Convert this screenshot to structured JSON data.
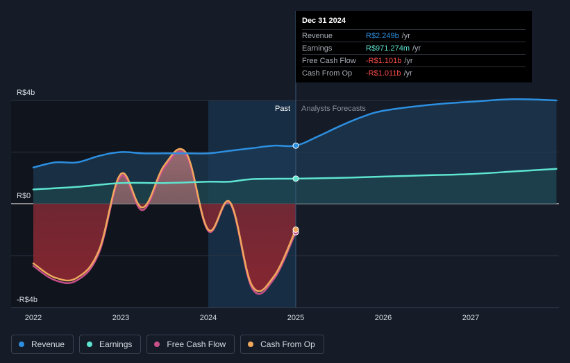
{
  "chart_data": {
    "type": "line",
    "y_ticks": [
      "R$4b",
      "R$0",
      "-R$4b"
    ],
    "x_ticks": [
      "2022",
      "2023",
      "2024",
      "2025",
      "2026",
      "2027"
    ],
    "ylim": [
      -4,
      4
    ],
    "xlim": [
      2021.78,
      2027.98
    ],
    "past_label": "Past",
    "forecast_label": "Analysts Forecasts",
    "forecast_start": 2025.0,
    "series": [
      {
        "name": "Revenue",
        "color": "#2d8fe0",
        "x": [
          2022.0,
          2022.25,
          2022.5,
          2022.75,
          2023.0,
          2023.25,
          2023.5,
          2023.75,
          2024.0,
          2024.25,
          2024.5,
          2024.75,
          2025.0,
          2025.25,
          2025.5,
          2025.75,
          2026.0,
          2026.5,
          2027.0,
          2027.5,
          2027.98
        ],
        "values": [
          1.4,
          1.6,
          1.6,
          1.85,
          2.0,
          1.95,
          1.95,
          1.95,
          1.95,
          2.05,
          2.15,
          2.25,
          2.25,
          2.6,
          3.0,
          3.35,
          3.6,
          3.82,
          3.95,
          4.05,
          4.0
        ]
      },
      {
        "name": "Earnings",
        "color": "#5ee4d0",
        "x": [
          2022.0,
          2022.5,
          2023.0,
          2023.5,
          2024.0,
          2024.25,
          2024.5,
          2025.0,
          2025.5,
          2026.0,
          2026.5,
          2027.0,
          2027.5,
          2027.98
        ],
        "values": [
          0.55,
          0.65,
          0.8,
          0.8,
          0.85,
          0.85,
          0.95,
          0.97,
          1.0,
          1.05,
          1.1,
          1.15,
          1.25,
          1.35
        ]
      },
      {
        "name": "Free Cash Flow",
        "color": "#c8508a",
        "x": [
          2022.0,
          2022.25,
          2022.5,
          2022.75,
          2023.0,
          2023.25,
          2023.5,
          2023.75,
          2024.0,
          2024.25,
          2024.5,
          2024.75,
          2025.0
        ],
        "values": [
          -2.4,
          -2.95,
          -2.95,
          -1.9,
          1.05,
          -0.25,
          1.4,
          1.85,
          -1.05,
          0.0,
          -3.25,
          -2.9,
          -1.1
        ]
      },
      {
        "name": "Cash From Op",
        "color": "#f0a85c",
        "x": [
          2022.0,
          2022.25,
          2022.5,
          2022.75,
          2023.0,
          2023.25,
          2023.5,
          2023.75,
          2024.0,
          2024.25,
          2024.5,
          2024.75,
          2025.0
        ],
        "values": [
          -2.3,
          -2.85,
          -2.85,
          -1.8,
          1.15,
          -0.15,
          1.5,
          1.95,
          -1.0,
          0.05,
          -3.15,
          -2.8,
          -1.0
        ]
      }
    ]
  },
  "tooltip": {
    "date": "Dec 31 2024",
    "rows": [
      {
        "label": "Revenue",
        "value": "R$2.249b",
        "unit": "/yr",
        "color": "#2d8fe0"
      },
      {
        "label": "Earnings",
        "value": "R$971.274m",
        "unit": "/yr",
        "color": "#5ee4d0"
      },
      {
        "label": "Free Cash Flow",
        "value": "-R$1.101b",
        "unit": "/yr",
        "color": "#ff4d4d"
      },
      {
        "label": "Cash From Op",
        "value": "-R$1.011b",
        "unit": "/yr",
        "color": "#ff4d4d"
      }
    ]
  },
  "legend": [
    {
      "label": "Revenue",
      "color": "#2d8fe0"
    },
    {
      "label": "Earnings",
      "color": "#5ee4d0"
    },
    {
      "label": "Free Cash Flow",
      "color": "#c8508a"
    },
    {
      "label": "Cash From Op",
      "color": "#f0a85c"
    }
  ]
}
